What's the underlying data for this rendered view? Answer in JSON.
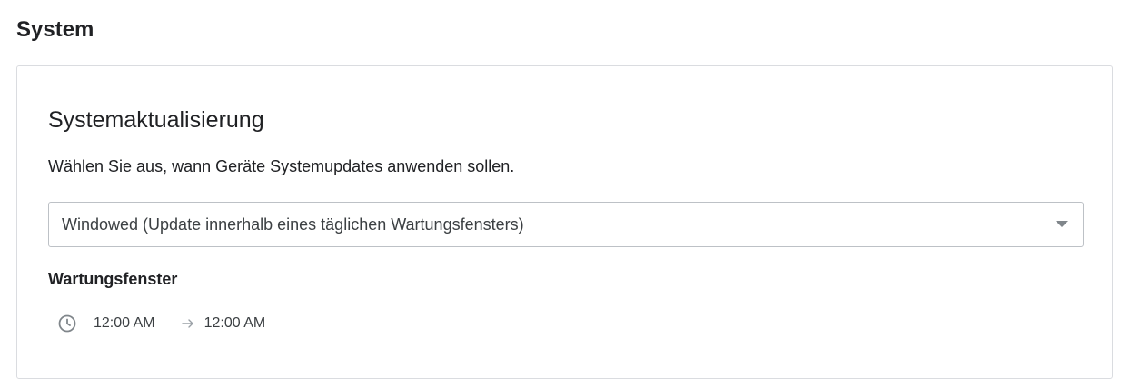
{
  "section": {
    "title": "System"
  },
  "update_card": {
    "title": "Systemaktualisierung",
    "description": "Wählen Sie aus, wann Geräte Systemupdates anwenden sollen.",
    "policy_select": {
      "selected": "Windowed (Update innerhalb eines täglichen Wartungsfensters)",
      "icon": "chevron-down-icon"
    },
    "maintenance_window": {
      "label": "Wartungsfenster",
      "icon": "clock-icon",
      "start": "12:00 AM",
      "separator_icon": "arrow-right-icon",
      "end": "12:00 AM"
    }
  },
  "colors": {
    "text": "#202124",
    "border": "#dadce0",
    "select_border": "#bdc1c6",
    "icon": "#80868b"
  }
}
